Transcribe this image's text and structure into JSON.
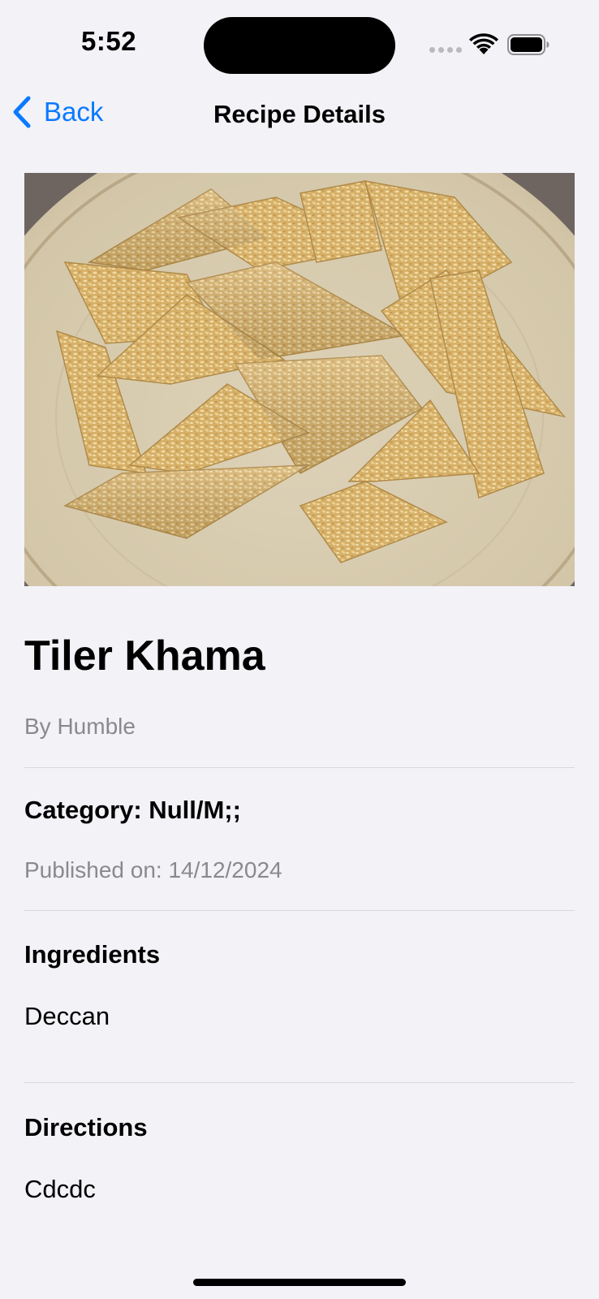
{
  "status_bar": {
    "time": "5:52",
    "wifi_icon": "wifi-icon",
    "battery_icon": "battery-icon"
  },
  "nav": {
    "back_label": "Back",
    "back_icon": "chevron-left-icon",
    "title": "Recipe Details",
    "accent_color": "#0a7aff"
  },
  "recipe": {
    "image_alt": "Sesame seed brittle pieces on a plate",
    "title": "Tiler Khama",
    "author": "By Humble",
    "category": "Category: Null/M;;",
    "published": "Published on: 14/12/2024",
    "ingredients_heading": "Ingredients",
    "ingredients": "Deccan",
    "directions_heading": "Directions",
    "directions": "Cdcdc"
  }
}
